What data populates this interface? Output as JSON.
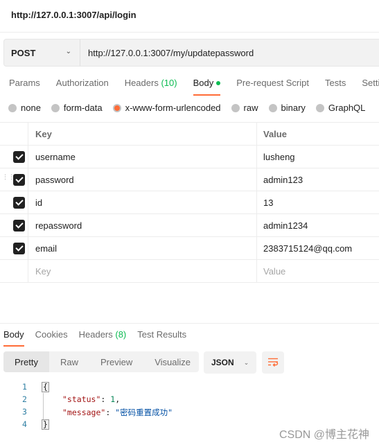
{
  "request_title": "http://127.0.0.1:3007/api/login",
  "urlbar": {
    "method": "POST",
    "url": "http://127.0.0.1:3007/my/updatepassword"
  },
  "request_tabs": [
    {
      "label": "Params"
    },
    {
      "label": "Authorization"
    },
    {
      "label": "Headers",
      "count": "(10)"
    },
    {
      "label": "Body",
      "active": true
    },
    {
      "label": "Pre-request Script"
    },
    {
      "label": "Tests"
    },
    {
      "label": "Settings"
    }
  ],
  "body_types": [
    {
      "label": "none"
    },
    {
      "label": "form-data"
    },
    {
      "label": "x-www-form-urlencoded",
      "selected": true
    },
    {
      "label": "raw"
    },
    {
      "label": "binary"
    },
    {
      "label": "GraphQL"
    }
  ],
  "params_table": {
    "headers": {
      "key": "Key",
      "value": "Value"
    },
    "rows": [
      {
        "key": "username",
        "value": "lusheng",
        "checked": true
      },
      {
        "key": "password",
        "value": "admin123",
        "checked": true
      },
      {
        "key": "id",
        "value": "13",
        "checked": true
      },
      {
        "key": "repassword",
        "value": "admin1234",
        "checked": true
      },
      {
        "key": "email",
        "value": "2383715124@qq.com",
        "checked": true
      }
    ],
    "placeholder": {
      "key": "Key",
      "value": "Value"
    }
  },
  "response_tabs": [
    {
      "label": "Body",
      "active": true
    },
    {
      "label": "Cookies"
    },
    {
      "label": "Headers",
      "count": "(8)"
    },
    {
      "label": "Test Results"
    }
  ],
  "view_modes": [
    "Pretty",
    "Raw",
    "Preview",
    "Visualize"
  ],
  "format": "JSON",
  "wrap_icon": "wrap-lines-icon",
  "response_code": {
    "line_numbers": [
      "1",
      "2",
      "3",
      "4"
    ],
    "open_brace": "{",
    "close_brace": "}",
    "status_key": "\"status\"",
    "status_value": "1",
    "message_key": "\"message\"",
    "message_value": "\"密码重置成功\""
  },
  "watermark": "CSDN @博主花神",
  "colors": {
    "accent": "#ff6c37",
    "success": "#0cbb52"
  }
}
